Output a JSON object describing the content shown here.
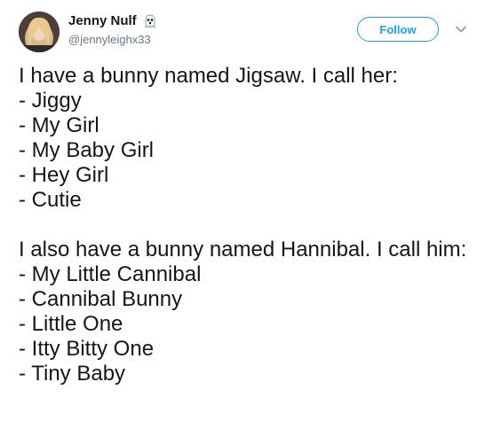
{
  "header": {
    "display_name": "Jenny Nulf",
    "handle": "@jennyleighx33",
    "follow_label": "Follow",
    "emoji_icon": "ghost-emoji-icon",
    "caret_icon": "chevron-down-icon",
    "accent_color": "#1da1f2"
  },
  "tweet": {
    "para1": {
      "intro": "I have a bunny named Jigsaw. I call her:",
      "items": [
        "- Jiggy",
        "- My Girl",
        "- My Baby Girl",
        "- Hey Girl",
        "- Cutie"
      ]
    },
    "para2": {
      "intro": "I also have a bunny named Hannibal. I call him:",
      "items": [
        "- My Little Cannibal",
        "- Cannibal Bunny",
        "- Little One",
        "- Itty Bitty One",
        "- Tiny Baby"
      ]
    }
  }
}
